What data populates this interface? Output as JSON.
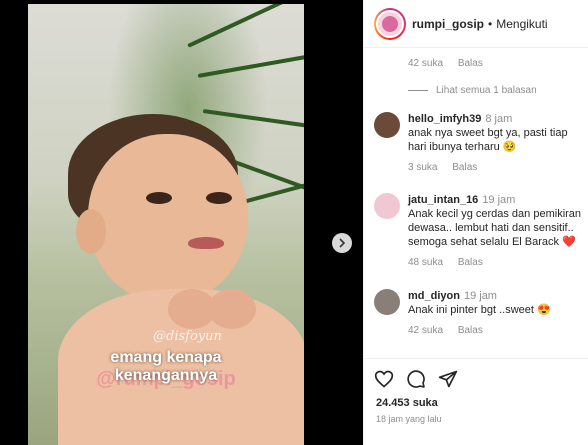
{
  "post": {
    "overlay_watermark": "@disfoyun",
    "caption_line1": "emang kenapa",
    "caption_line2": "kenangannya",
    "overlay_handle": "@rumpi_gosip"
  },
  "header": {
    "username": "rumpi_gosip",
    "separator": "•",
    "follow_label": "Mengikuti"
  },
  "top_comment_meta": {
    "likes": "42 suka",
    "reply_label": "Balas"
  },
  "view_replies": "Lihat semua 1 balasan",
  "comments": [
    {
      "user": "hello_imfyh39",
      "time": "8 jam",
      "text": "anak nya sweet bgt ya, pasti tiap hari ibunya terharu 🥹",
      "likes": "3 suka",
      "reply_label": "Balas",
      "avatar_color": "#6b4a3a"
    },
    {
      "user": "jatu_intan_16",
      "time": "19 jam",
      "text": "Anak kecil yg cerdas dan pemikiran dewasa.. lembut hati dan sensitif.. semoga sehat selalu El Barack ❤️",
      "likes": "48 suka",
      "reply_label": "Balas",
      "avatar_color": "#f0c8d4"
    },
    {
      "user": "md_diyon",
      "time": "19 jam",
      "text": "Anak ini pinter bgt ..sweet 😍",
      "likes": "42 suka",
      "reply_label": "Balas",
      "avatar_color": "#8a7f78"
    }
  ],
  "footer": {
    "likes": "24.453 suka",
    "time_ago": "18 jam yang lalu"
  },
  "icons": {
    "like": "heart-icon",
    "comment": "comment-icon",
    "share": "share-icon",
    "next": "chevron-right-icon"
  }
}
